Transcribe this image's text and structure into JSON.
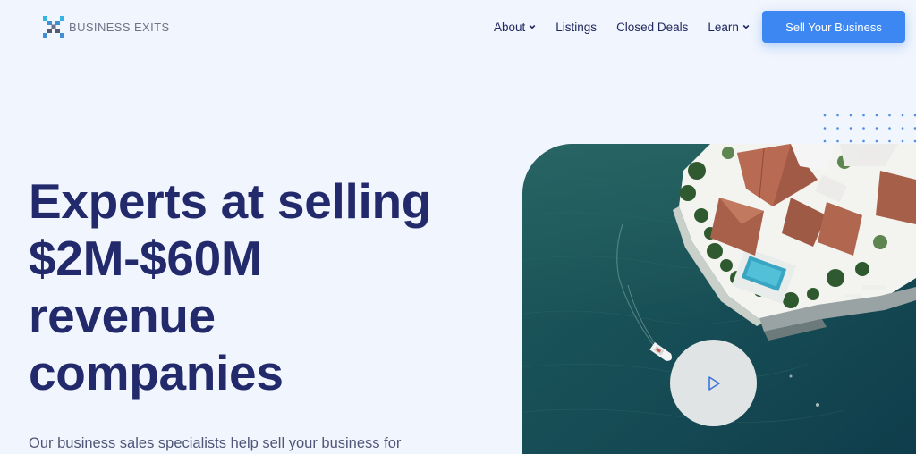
{
  "brand": {
    "name": "BUSINESS EXITS"
  },
  "nav": {
    "items": [
      {
        "label": "About",
        "has_dropdown": true
      },
      {
        "label": "Listings",
        "has_dropdown": false
      },
      {
        "label": "Closed Deals",
        "has_dropdown": false
      },
      {
        "label": "Learn",
        "has_dropdown": true
      }
    ],
    "cta_label": "Sell Your Business"
  },
  "hero": {
    "title_lines": [
      "Experts at selling",
      "$2M-$60M",
      "revenue",
      "companies"
    ],
    "subtitle": "Our business sales specialists help sell your business for"
  },
  "media": {
    "image_subject": "aerial-waterfront-villa-with-pool-and-boat",
    "play_icon": "play-icon"
  },
  "colors": {
    "accent": "#3d87f2",
    "heading": "#222a6c",
    "background": "#f1f5fd"
  }
}
